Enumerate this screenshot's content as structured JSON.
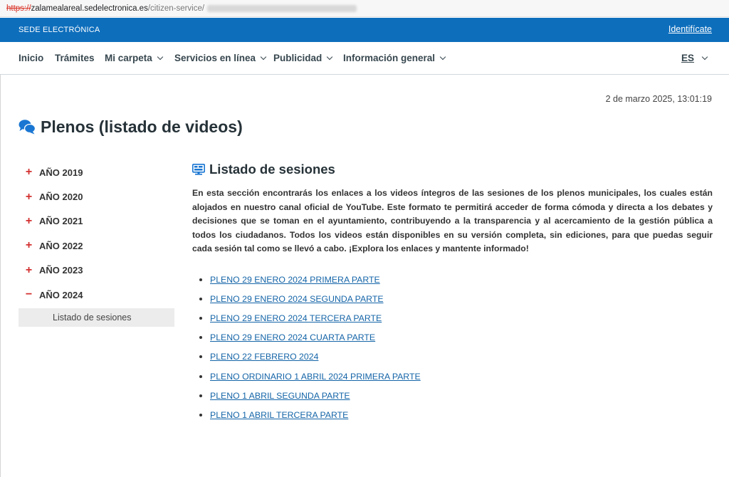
{
  "browser": {
    "url_scheme": "https://",
    "url_host": "zalamealareal.sedelectronica.es",
    "url_path": "/citizen-service/"
  },
  "header": {
    "sede_label": "SEDE ELECTRÓNICA",
    "login_label": "Identifícate",
    "bar_color": "#0d6ebc"
  },
  "nav": {
    "items": [
      {
        "label": "Inicio",
        "dropdown": false
      },
      {
        "label": "Trámites",
        "dropdown": false
      },
      {
        "label": "Mi carpeta",
        "dropdown": true
      },
      {
        "label": "Servicios en línea",
        "dropdown": true
      },
      {
        "label": "Publicidad",
        "dropdown": true
      },
      {
        "label": "Información general",
        "dropdown": true
      }
    ],
    "language": "ES"
  },
  "datetime": "2 de marzo 2025, 13:01:19",
  "page_title": "Plenos (listado de videos)",
  "page_title_icon": "chat-bubbles-icon",
  "sidebar": {
    "years": [
      {
        "sign": "+",
        "label": "AÑO 2019",
        "expanded": false
      },
      {
        "sign": "+",
        "label": "AÑO 2020",
        "expanded": false
      },
      {
        "sign": "+",
        "label": "AÑO 2021",
        "expanded": false
      },
      {
        "sign": "+",
        "label": "AÑO 2022",
        "expanded": false
      },
      {
        "sign": "+",
        "label": "AÑO 2023",
        "expanded": false
      },
      {
        "sign": "−",
        "label": "AÑO 2024",
        "expanded": true
      }
    ],
    "sub_item": "Listado de sesiones",
    "accent_color": "#d32f2f"
  },
  "main": {
    "section_title": "Listado de sesiones",
    "section_icon": "monitor-icon",
    "intro": "En esta sección encontrarás los enlaces a los videos íntegros de las sesiones de los plenos municipales, los cuales están alojados en nuestro canal oficial de YouTube. Este formato te permitirá acceder de forma cómoda y directa a los debates y decisiones que se toman en el ayuntamiento, contribuyendo a la transparencia y al acercamiento de la gestión pública a todos los ciudadanos. Todos los videos están disponibles en su versión completa, sin ediciones, para que puedas seguir cada sesión tal como se llevó a cabo. ¡Explora los enlaces y mantente informado!",
    "links": [
      "PLENO 29 ENERO 2024 PRIMERA PARTE",
      "PLENO 29 ENERO 2024 SEGUNDA PARTE",
      "PLENO 29 ENERO 2024 TERCERA PARTE",
      "PLENO 29 ENERO 2024 CUARTA PARTE",
      "PLENO 22 FEBRERO 2024",
      "PLENO ORDINARIO 1 ABRIL 2024 PRIMERA PARTE",
      "PLENO 1 ABRIL SEGUNDA PARTE",
      "PLENO 1 ABRIL TERCERA PARTE"
    ],
    "link_color": "#1565a8"
  }
}
